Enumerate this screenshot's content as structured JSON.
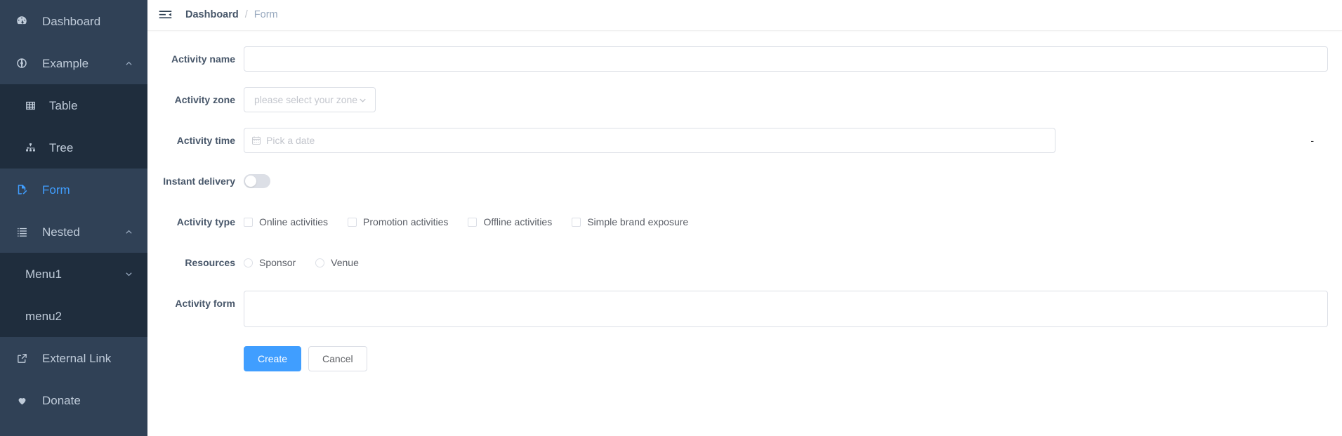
{
  "sidebar": {
    "items": [
      {
        "label": "Dashboard",
        "icon": "dashboard-icon",
        "state": "normal",
        "level": 0,
        "arrow": "none"
      },
      {
        "label": "Example",
        "icon": "component-icon",
        "state": "normal",
        "level": 0,
        "arrow": "up"
      },
      {
        "label": "Table",
        "icon": "table-icon",
        "state": "sub",
        "level": 1,
        "arrow": "none"
      },
      {
        "label": "Tree",
        "icon": "tree-icon",
        "state": "sub",
        "level": 1,
        "arrow": "none"
      },
      {
        "label": "Form",
        "icon": "form-icon",
        "state": "active",
        "level": 0,
        "arrow": "none"
      },
      {
        "label": "Nested",
        "icon": "nested-icon",
        "state": "normal",
        "level": 0,
        "arrow": "up"
      },
      {
        "label": "Menu1",
        "icon": "none",
        "state": "sub",
        "level": 1,
        "arrow": "down"
      },
      {
        "label": "menu2",
        "icon": "none",
        "state": "sub",
        "level": 1,
        "arrow": "none"
      },
      {
        "label": "External Link",
        "icon": "link-icon",
        "state": "normal",
        "level": 0,
        "arrow": "none"
      },
      {
        "label": "Donate",
        "icon": "heart-icon",
        "state": "normal",
        "level": 0,
        "arrow": "none"
      }
    ]
  },
  "navbar": {
    "hamburger_icon": "hamburger-collapse-icon",
    "breadcrumb": {
      "root": "Dashboard",
      "separator": "/",
      "current": "Form"
    }
  },
  "form": {
    "activity_name": {
      "label": "Activity name",
      "value": "",
      "placeholder": ""
    },
    "activity_zone": {
      "label": "Activity zone",
      "selected": "please select your zone",
      "arrow_icon": "chevron-down-icon"
    },
    "activity_time": {
      "label": "Activity time",
      "placeholder": "Pick a date",
      "value": "",
      "icon": "calendar-icon",
      "range_separator": "-"
    },
    "instant_delivery": {
      "label": "Instant delivery",
      "checked": false
    },
    "activity_type": {
      "label": "Activity type",
      "options": [
        {
          "label": "Online activities",
          "checked": false
        },
        {
          "label": "Promotion activities",
          "checked": false
        },
        {
          "label": "Offline activities",
          "checked": false
        },
        {
          "label": "Simple brand exposure",
          "checked": false
        }
      ]
    },
    "resources": {
      "label": "Resources",
      "options": [
        {
          "label": "Sponsor",
          "checked": false
        },
        {
          "label": "Venue",
          "checked": false
        }
      ]
    },
    "activity_form": {
      "label": "Activity form",
      "value": "",
      "placeholder": ""
    },
    "actions": {
      "create": "Create",
      "cancel": "Cancel"
    }
  },
  "colors": {
    "sidebar_bg": "#304156",
    "sidebar_sub_bg": "#1f2d3d",
    "accent": "#409EFF",
    "menu_text": "#bfcbd9",
    "label_text": "#48576a"
  }
}
